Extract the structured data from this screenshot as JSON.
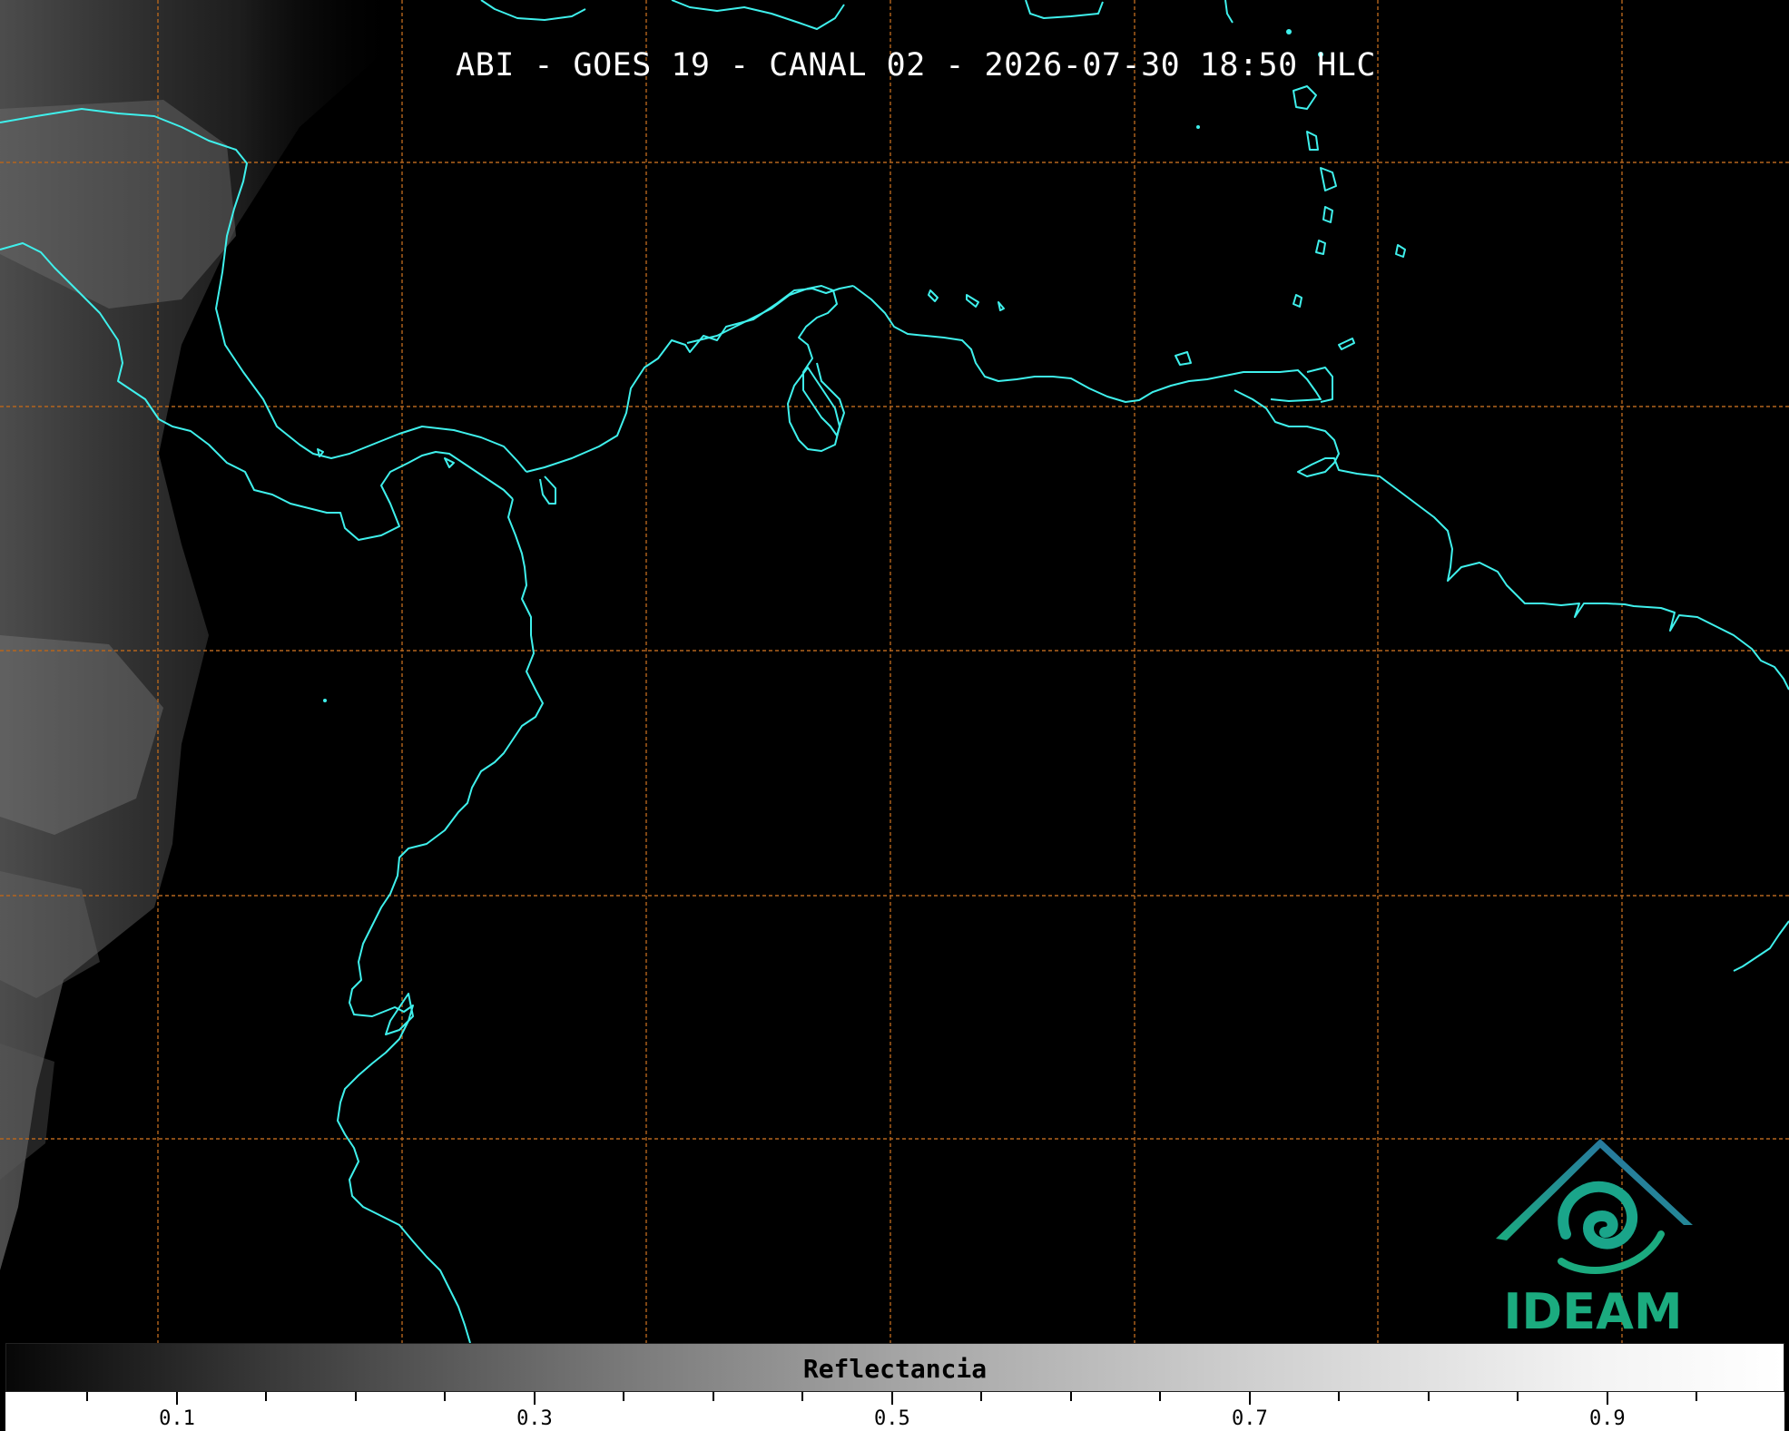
{
  "title": "ABI - GOES 19 - CANAL 02 - 2026-07-30 18:50 HLC",
  "colorbar": {
    "label": "Reflectancia",
    "colormap": "grayscale",
    "tick_labels": [
      "0.1",
      "0.3",
      "0.5",
      "0.7",
      "0.9"
    ]
  },
  "logo": {
    "text": "IDEAM",
    "colors": [
      "#2b6aa8",
      "#1bab7f"
    ]
  },
  "map_style": {
    "background": "#000000",
    "coastline_color": "#3ff0ec",
    "grid_color": "#b5651d",
    "grid_style": "dashed"
  }
}
